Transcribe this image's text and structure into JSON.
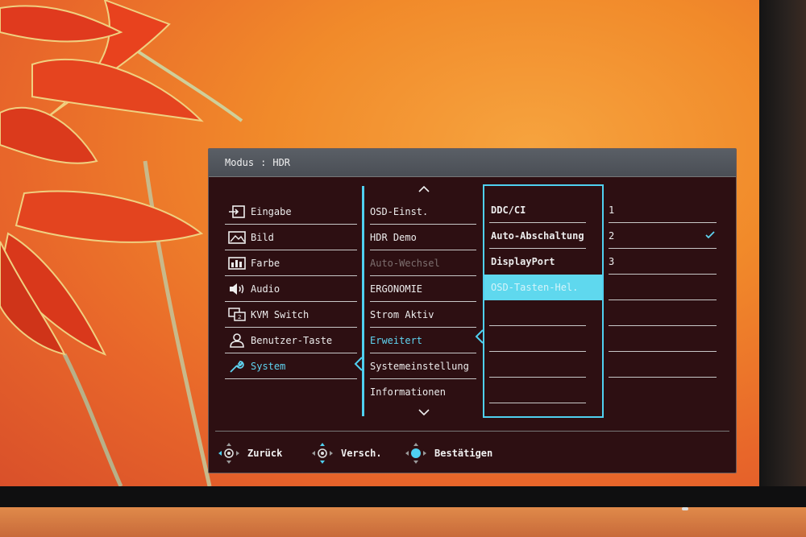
{
  "osd": {
    "header": {
      "label": "Modus",
      "separator": ":",
      "value": "HDR"
    },
    "menu": [
      {
        "label": "Eingabe",
        "icon": "input-icon"
      },
      {
        "label": "Bild",
        "icon": "picture-icon"
      },
      {
        "label": "Farbe",
        "icon": "color-icon"
      },
      {
        "label": "Audio",
        "icon": "speaker-icon"
      },
      {
        "label": "KVM Switch",
        "icon": "kvm-switch-icon"
      },
      {
        "label": "Benutzer-Taste",
        "icon": "user-icon"
      },
      {
        "label": "System",
        "icon": "wrench-icon",
        "selected": true
      }
    ],
    "submenu": {
      "scroll_up": "up-arrow-icon",
      "scroll_down": "down-arrow-icon",
      "items": [
        {
          "label": "OSD-Einst."
        },
        {
          "label": "HDR Demo"
        },
        {
          "label": "Auto-Wechsel",
          "disabled": true
        },
        {
          "label": "ERGONOMIE"
        },
        {
          "label": "Strom Aktiv"
        },
        {
          "label": "Erweitert",
          "selected": true
        },
        {
          "label": "Systemeinstellung"
        },
        {
          "label": "Informationen"
        }
      ]
    },
    "options": [
      {
        "label": "DDC/CI"
      },
      {
        "label": "Auto-Abschaltung"
      },
      {
        "label": "DisplayPort"
      },
      {
        "label": "OSD-Tasten-Hel.",
        "highlighted": true
      }
    ],
    "values": [
      {
        "label": "1"
      },
      {
        "label": "2",
        "checked": true
      },
      {
        "label": "3"
      }
    ],
    "footer": [
      {
        "label": "Zurück",
        "icon": "joystick-left-icon"
      },
      {
        "label": "Versch.",
        "icon": "joystick-updown-icon"
      },
      {
        "label": "Bestätigen",
        "icon": "joystick-center-icon"
      }
    ],
    "colors": {
      "accent": "#4fd0f0",
      "background": "#2d0f12",
      "header": "#53575e"
    }
  }
}
